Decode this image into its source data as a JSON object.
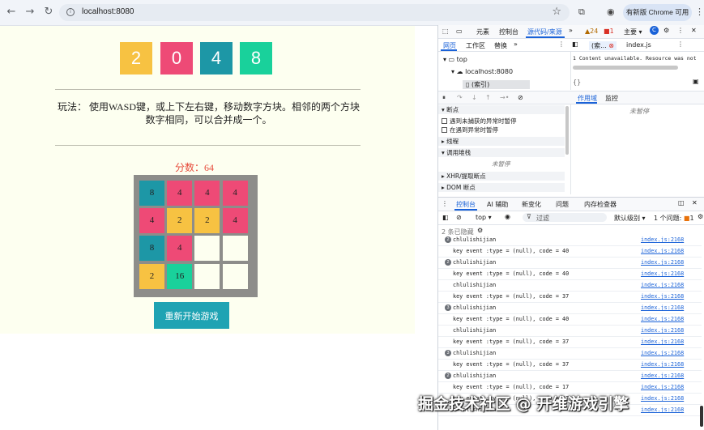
{
  "browser": {
    "url": "localhost:8080",
    "update_label": "有新版 Chrome 可用"
  },
  "game": {
    "title_tiles": [
      {
        "text": "2",
        "color": "#f7c242"
      },
      {
        "text": "0",
        "color": "#ee4a76"
      },
      {
        "text": "4",
        "color": "#1d97a6"
      },
      {
        "text": "8",
        "color": "#19d19b"
      }
    ],
    "instructions_line1": "玩法： 使用WASD键，或上下左右键，移动数字方块。相邻的两个方块",
    "instructions_line2": "数字相同，可以合并成一个。",
    "score_text": "分数：64",
    "board": [
      [
        "8",
        "4",
        "4",
        "4"
      ],
      [
        "4",
        "2",
        "2",
        "4"
      ],
      [
        "8",
        "4",
        "",
        ""
      ],
      [
        "2",
        "16",
        "",
        ""
      ]
    ],
    "board_colors": [
      [
        "#1d97a6",
        "#ee4a76",
        "#ee4a76",
        "#ee4a76"
      ],
      [
        "#ee4a76",
        "#f7c242",
        "#f7c242",
        "#ee4a76"
      ],
      [
        "#1d97a6",
        "#ee4a76",
        "#fdfff0",
        "#fdfff0"
      ],
      [
        "#f7c242",
        "#19d19b",
        "#fdfff0",
        "#fdfff0"
      ]
    ],
    "restart_label": "重新开始游戏"
  },
  "devtools": {
    "main_tabs": [
      "元素",
      "控制台",
      "源代码/来源"
    ],
    "warn_count": "24",
    "err_count": "1",
    "theme_label": "主要",
    "nav_tabs": [
      "网页",
      "工作区",
      "替换"
    ],
    "file_tabs": [
      "(索...",
      "index.js"
    ],
    "tree": [
      "top",
      "localhost:8080",
      "(索引)"
    ],
    "content_msg": "1  Content unavailable. Resource was not",
    "right_tabs": [
      "作用域",
      "监控"
    ],
    "not_paused": "未暂停",
    "breakpoints_title": "断点",
    "bp_opts": [
      "遇到未捕获的异常时暂停",
      "在遇到异常时暂停"
    ],
    "threads": "线程",
    "callstack": "调用堆栈",
    "callstack_empty": "未暂停",
    "xhr": "XHR/提取断点",
    "dom": "DOM 断点",
    "drawer_tabs": [
      "控制台",
      "AI 辅助",
      "新变化",
      "问题",
      "内存检查器"
    ],
    "console_context": "top",
    "filter_placeholder": "过滤",
    "level": "默认级别",
    "issues": "1 个问题:",
    "issues_count": "1",
    "hidden": "2 条已隐藏",
    "logs": [
      {
        "count": "2",
        "msg": "chlulishijian",
        "src": "index.js:2168"
      },
      {
        "count": "",
        "msg": "key event :type = (null), code = 40",
        "src": "index.js:2168"
      },
      {
        "count": "2",
        "msg": "chlulishijian",
        "src": "index.js:2168"
      },
      {
        "count": "",
        "msg": "key event :type = (null), code = 40",
        "src": "index.js:2168"
      },
      {
        "count": "",
        "msg": "chlulishijian",
        "src": "index.js:2168"
      },
      {
        "count": "",
        "msg": "key event :type = (null), code = 37",
        "src": "index.js:2168"
      },
      {
        "count": "3",
        "msg": "chlulishijian",
        "src": "index.js:2168"
      },
      {
        "count": "",
        "msg": "key event :type = (null), code = 40",
        "src": "index.js:2168"
      },
      {
        "count": "",
        "msg": "chlulishijian",
        "src": "index.js:2168"
      },
      {
        "count": "",
        "msg": "key event :type = (null), code = 37",
        "src": "index.js:2168"
      },
      {
        "count": "3",
        "msg": "chlulishijian",
        "src": "index.js:2168"
      },
      {
        "count": "",
        "msg": "key event :type = (null), code = 37",
        "src": "index.js:2168"
      },
      {
        "count": "2",
        "msg": "chlulishijian",
        "src": "index.js:2168"
      },
      {
        "count": "",
        "msg": "key event :type = (null), code = 17",
        "src": "index.js:2168"
      },
      {
        "count": "",
        "msg": "key event :type = (null), code = 17",
        "src": "index.js:2168"
      },
      {
        "count": "",
        "msg": "chlulishijian",
        "src": "index.js:2168"
      }
    ]
  },
  "watermark": "掘金技术社区 @ 开维游戏引擎"
}
